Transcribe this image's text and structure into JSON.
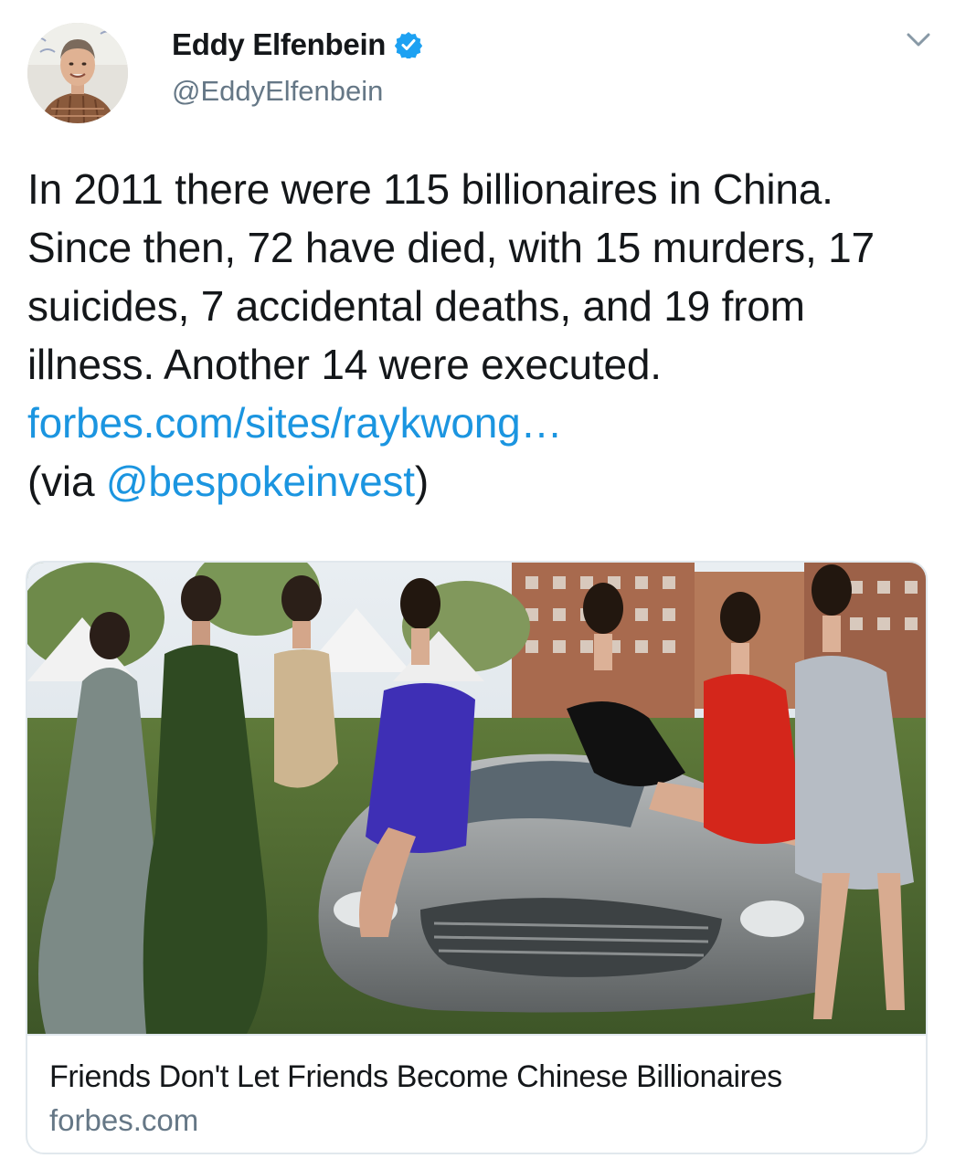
{
  "author": {
    "name": "Eddy Elfenbein",
    "handle": "@EddyElfenbein",
    "verified": true,
    "avatar_icon": "profile-photo"
  },
  "menu_icon": "chevron-down-icon",
  "tweet": {
    "text_before_link": "In 2011 there were 115 billionaires in China. Since then, 72 have died, with 15 murders, 17 suicides, 7 accidental deaths, and 19 from illness. Another 14 were executed. ",
    "link_text": "forbes.com/sites/raykwong…",
    "via_prefix": "(via ",
    "mention": "@bespokeinvest",
    "via_suffix": ")"
  },
  "card": {
    "image_icon": "article-photo",
    "title": "Friends Don't Let Friends Become Chinese Billionaires",
    "domain": "forbes.com"
  },
  "colors": {
    "link": "#1b95e0",
    "verified": "#1da1f2",
    "secondary_text": "#657786",
    "border": "#e1e8ed"
  }
}
